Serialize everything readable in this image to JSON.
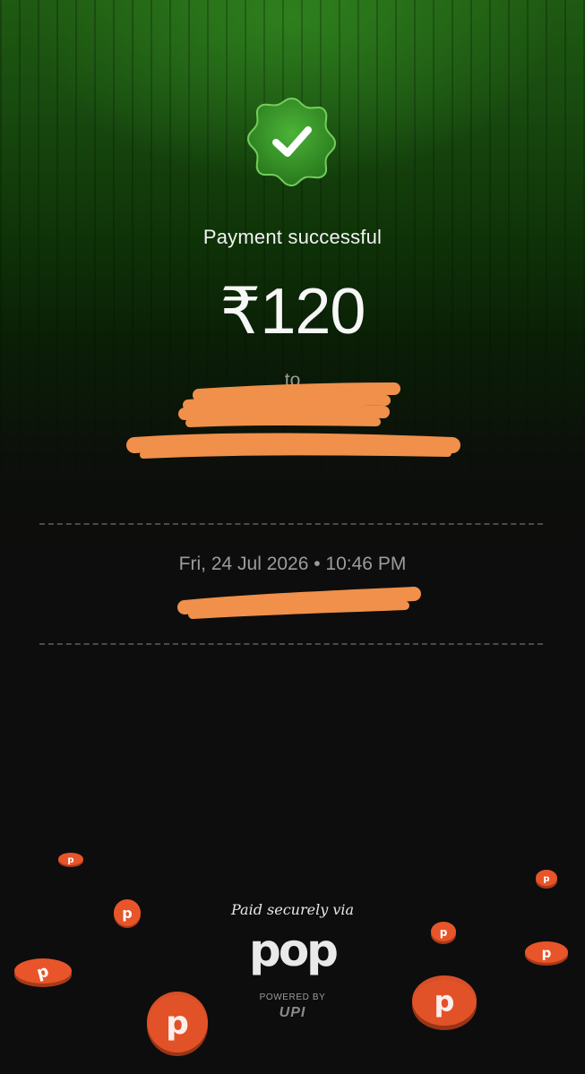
{
  "status": {
    "title": "Payment successful",
    "icon": "check-badge-icon"
  },
  "amount": {
    "value": "₹120"
  },
  "recipient": {
    "to_label": "to"
  },
  "transaction": {
    "datetime": "Fri, 24 Jul 2026 • 10:46 PM"
  },
  "footer": {
    "paid_via": "Paid securely via",
    "brand": "pop",
    "powered_by": "POWERED BY",
    "upi": "UPI",
    "coin_icon": "pop-coin-icon"
  },
  "colors": {
    "accent_green": "#3fae33",
    "redaction_orange": "#f0904a",
    "coin_orange": "#e8552a"
  }
}
